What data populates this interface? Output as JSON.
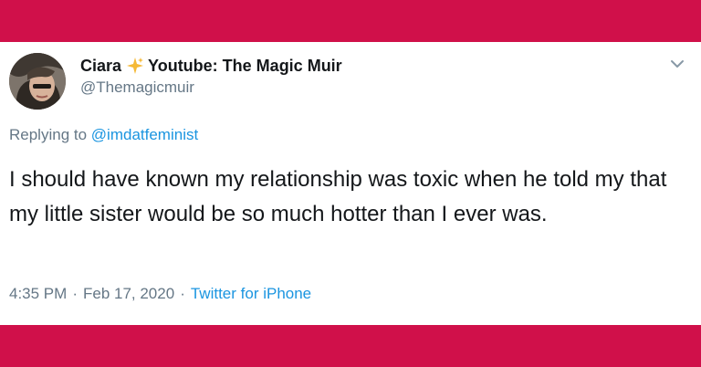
{
  "user": {
    "name": "Ciara",
    "display_suffix": "Youtube: The Magic Muir",
    "handle": "@Themagicmuir"
  },
  "reply": {
    "prefix": "Replying to",
    "target": "@imdatfeminist"
  },
  "tweet": {
    "text": "I should have known my relationship was toxic when he told my that my little sister would be so much hotter than I ever was."
  },
  "meta": {
    "time": "4:35 PM",
    "separator": "·",
    "date": "Feb 17, 2020",
    "source": "Twitter for iPhone"
  },
  "icons": {
    "sparkle": "sparkles-icon",
    "chevron": "chevron-down-icon",
    "avatar": "avatar"
  },
  "colors": {
    "frame": "#d0104a",
    "card": "#ffffff",
    "text": "#14171a",
    "muted": "#657786",
    "link": "#1b95e0",
    "sparkle": "#f5b936"
  }
}
